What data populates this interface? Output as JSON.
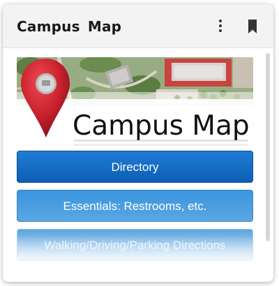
{
  "header": {
    "title": "Campus  Map"
  },
  "icons": {
    "more": "kebab-menu-icon",
    "bookmark": "bookmark-icon",
    "map_pin": "map-pin-icon"
  },
  "banner": {
    "title": "Campus Map"
  },
  "buttons": [
    {
      "label": "Directory"
    },
    {
      "label": "Essentials: Restrooms, etc."
    },
    {
      "label": "Walking/Driving/Parking Directions"
    }
  ],
  "colors": {
    "primary_button": "#0d5fb4",
    "secondary_button": "#4a9ee2",
    "pin_red": "#c8202d"
  }
}
